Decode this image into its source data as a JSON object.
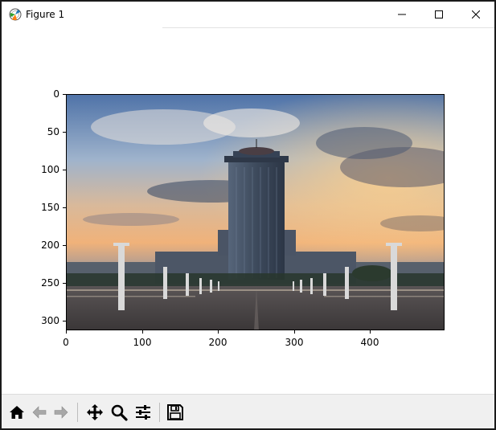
{
  "window": {
    "title": "Figure 1",
    "app_icon": "matplotlib-icon",
    "controls": {
      "minimize_icon": "minimize-icon",
      "maximize_icon": "maximize-icon",
      "close_icon": "close-icon"
    }
  },
  "axes": {
    "y_ticks": [
      "0",
      "50",
      "100",
      "150",
      "200",
      "250",
      "300"
    ],
    "x_ticks": [
      "0",
      "100",
      "200",
      "300",
      "400"
    ],
    "x_range": [
      0,
      500
    ],
    "y_range": [
      0,
      313
    ],
    "image_description": "photo of tall building at sunset with plaza and lamp posts"
  },
  "toolbar": {
    "buttons": [
      {
        "name": "home-button",
        "icon": "home-icon"
      },
      {
        "name": "back-button",
        "icon": "arrow-left-icon"
      },
      {
        "name": "forward-button",
        "icon": "arrow-right-icon"
      },
      {
        "name": "pan-button",
        "icon": "move-icon"
      },
      {
        "name": "zoom-button",
        "icon": "magnifier-icon"
      },
      {
        "name": "configure-subplots-button",
        "icon": "sliders-icon"
      },
      {
        "name": "save-button",
        "icon": "floppy-icon"
      }
    ]
  },
  "colors": {
    "toolbar_bg": "#f0f0f0",
    "sky_top": "#4f73a8",
    "sky_bottom": "#f0b27a",
    "building": "#3d4a5c",
    "plaza": "#4a4645"
  }
}
